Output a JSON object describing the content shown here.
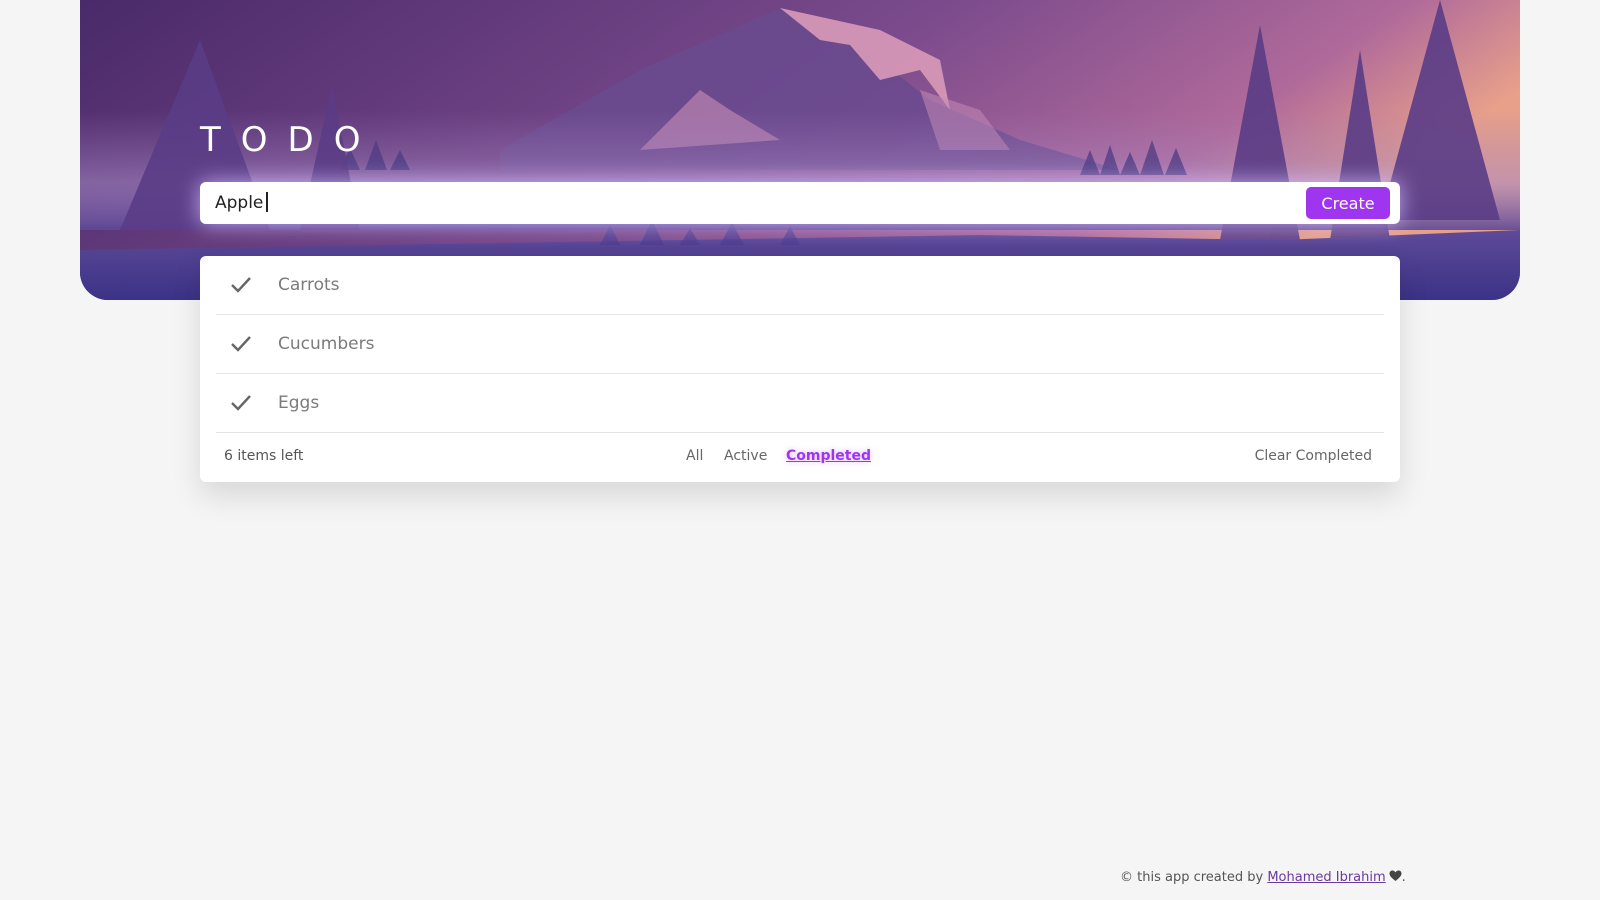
{
  "header": {
    "title": "TODO"
  },
  "entry": {
    "value": "Apple",
    "create_label": "Create"
  },
  "todos": [
    {
      "label": "Carrots",
      "completed": true
    },
    {
      "label": "Cucumbers",
      "completed": true
    },
    {
      "label": "Eggs",
      "completed": true
    }
  ],
  "footer": {
    "items_left": "6 items left",
    "filters": {
      "all": "All",
      "active": "Active",
      "completed": "Completed"
    },
    "selected_filter": "Completed",
    "clear_completed": "Clear Completed"
  },
  "credit": {
    "prefix": "© this app created by",
    "author": "Mohamed Ibrahim",
    "suffix": "."
  },
  "icons": {
    "check": "check-icon",
    "heart": "heart-icon"
  },
  "colors": {
    "accent": "#a035f0",
    "background": "#f5f5f5",
    "card": "#ffffff",
    "hero_top": "#4e2c6e",
    "hero_bottom": "#3d3385"
  }
}
